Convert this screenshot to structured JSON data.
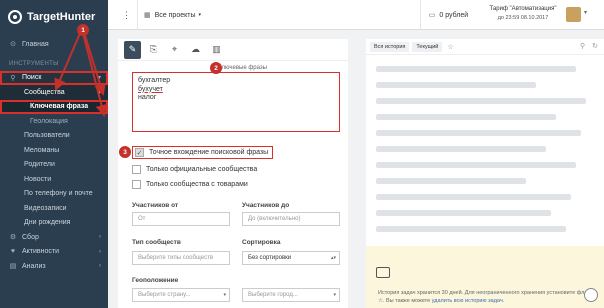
{
  "app": {
    "logo_text": "TargetHunter"
  },
  "sidebar": {
    "home_label": "Главная",
    "section_label": "ИНСТРУМЕНТЫ",
    "search_label": "Поиск",
    "communities_label": "Сообщества",
    "keyword_label": "Ключевая фраза",
    "geolocation_label": "Геолокация",
    "items": [
      "Пользователи",
      "Меломаны",
      "Родители",
      "Новости",
      "По телефону и почте",
      "Видеозаписи",
      "Дни рождения"
    ],
    "collection_label": "Сбор",
    "activity_label": "Активности",
    "analysis_label": "Анализ"
  },
  "topbar": {
    "projects_label": "Все проекты",
    "balance": "0 рублей",
    "tariff_line1": "Тариф \"Автоматизация\"",
    "tariff_line2": "до 23:59 08.10.2017"
  },
  "form": {
    "keywords_title": "Ключевые фразы",
    "keywords": [
      "бухгалтер",
      "бухучет",
      "налог"
    ],
    "exact_match_label": "Точное вхождение поисковой фразы",
    "exact_match_checked": true,
    "official_only_label": "Только официальные сообщества",
    "with_goods_label": "Только сообщества с товарами",
    "members_from_label": "Участников от",
    "members_from_placeholder": "От",
    "members_to_label": "Участников до",
    "members_to_placeholder": "До (включительно)",
    "community_type_label": "Тип сообществ",
    "community_type_placeholder": "Выберите типы сообществ",
    "sort_label": "Сортировка",
    "sort_value": "Без сортировки",
    "geo_label": "Геоположение",
    "country_placeholder": "Выберите страну...",
    "city_placeholder": "Выберите город..."
  },
  "right_panel": {
    "tab_history": "Вся история",
    "tab_current": "Текущий",
    "history_text": "История задач хранится 30 дней. Для неограниченного хранения установите флаг - ☆. Вы также можете",
    "history_link": "удалить всю историю задач."
  },
  "badges": [
    "1",
    "2",
    "3"
  ],
  "colors": {
    "sidebar_bg": "#2b3e50",
    "highlight_red": "#d9302a",
    "badge_red": "#c4302a",
    "history_footer": "#fbf6dc"
  },
  "icons": [
    "logo-icon",
    "home-icon",
    "search-icon",
    "edit-icon",
    "copy-icon",
    "location-icon",
    "cloud-upload-icon",
    "book-icon",
    "star-icon",
    "video-icon",
    "chat-icon"
  ]
}
